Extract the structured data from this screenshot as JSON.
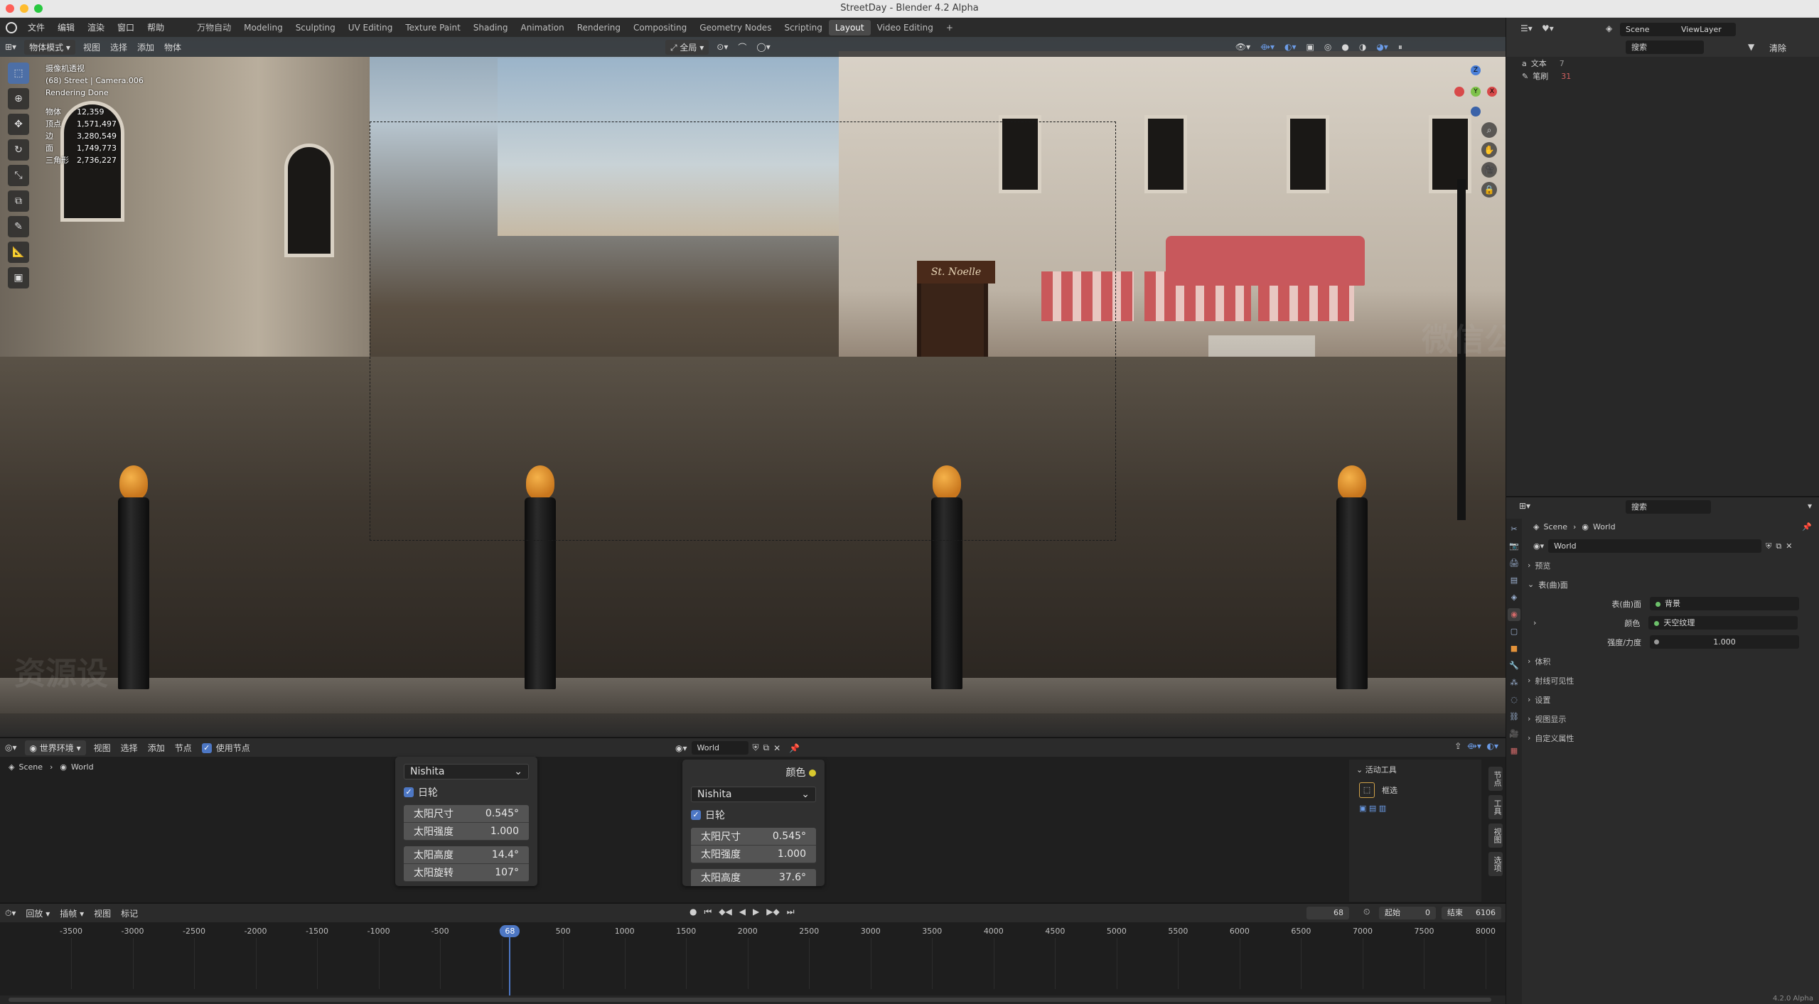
{
  "window": {
    "title": "StreetDay - Blender 4.2 Alpha",
    "traffic_lights": [
      "#fe5f57",
      "#febc2e",
      "#28c840"
    ]
  },
  "menu": [
    "文件",
    "编辑",
    "渲染",
    "窗口",
    "帮助"
  ],
  "workspaces": [
    "万物自动",
    "Modeling",
    "Sculpting",
    "UV Editing",
    "Texture Paint",
    "Shading",
    "Animation",
    "Rendering",
    "Compositing",
    "Geometry Nodes",
    "Scripting",
    "Layout",
    "Video Editing"
  ],
  "active_workspace": "Layout",
  "viewport": {
    "mode": "物体模式",
    "menus": [
      "视图",
      "选择",
      "添加",
      "物体"
    ],
    "transform_orientation": "全局",
    "overlay_title": "摄像机透视",
    "overlay_subtitle": "(68) Street | Camera.006",
    "render_status": "Rendering Done",
    "stats": [
      {
        "label": "物体",
        "value": "12,359"
      },
      {
        "label": "顶点",
        "value": "1,571,497"
      },
      {
        "label": "边",
        "value": "3,280,549"
      },
      {
        "label": "面",
        "value": "1,749,773"
      },
      {
        "label": "三角形",
        "value": "2,736,227"
      }
    ],
    "shop_sign": "St. Noelle",
    "watermark_left": "资源设",
    "watermark_right": "微信公"
  },
  "outliner": {
    "scene": "Scene",
    "view_layer": "ViewLayer",
    "search_placeholder": "搜索",
    "filter_label": "清除",
    "rows": [
      {
        "label": "文本",
        "count": "7"
      },
      {
        "label": "笔刷",
        "count": "31"
      }
    ]
  },
  "properties": {
    "search_placeholder": "搜索",
    "breadcrumb_scene": "Scene",
    "breadcrumb_world": "World",
    "world_name": "World",
    "sections": {
      "preview": "预览",
      "surface": "表(曲)面",
      "volume": "体积",
      "ray_visibility": "射线可见性",
      "settings": "设置",
      "viewport_display": "视图显示",
      "custom_props": "自定义属性"
    },
    "surface_label": "表(曲)面",
    "surface_value": "背景",
    "color_label": "颜色",
    "color_value": "天空纹理",
    "strength_label": "强度/力度",
    "strength_value": "1.000"
  },
  "node_editor": {
    "editor_type": "世界环境",
    "menus": [
      "视图",
      "选择",
      "添加",
      "节点"
    ],
    "use_nodes_label": "使用节点",
    "breadcrumb_scene": "Scene",
    "breadcrumb_world": "World",
    "world_name": "World",
    "node_left": {
      "sky_type": "Nishita",
      "sun_disc": "日轮",
      "fields": [
        {
          "label": "太阳尺寸",
          "value": "0.545°"
        },
        {
          "label": "太阳强度",
          "value": "1.000"
        },
        {
          "label": "太阳高度",
          "value": "14.4°"
        },
        {
          "label": "太阳旋转",
          "value": "107°"
        }
      ]
    },
    "node_right": {
      "output_label": "颜色",
      "sky_type": "Nishita",
      "sun_disc": "日轮",
      "fields": [
        {
          "label": "太阳尺寸",
          "value": "0.545°"
        },
        {
          "label": "太阳强度",
          "value": "1.000"
        },
        {
          "label": "太阳高度",
          "value": "37.6°"
        }
      ]
    },
    "tool_panel": {
      "header": "活动工具",
      "tool": "框选"
    },
    "sidebar_tabs": [
      "节点",
      "工具",
      "视图",
      "选项"
    ]
  },
  "timeline": {
    "menus": [
      "回放",
      "插帧",
      "视图",
      "标记"
    ],
    "current_frame": "68",
    "start_label": "起始",
    "start_value": "0",
    "end_label": "结束",
    "end_value": "6106",
    "ticks": [
      "-3500",
      "-3000",
      "-2500",
      "-2000",
      "-1500",
      "-1000",
      "-500",
      "0",
      "500",
      "1000",
      "1500",
      "2000",
      "2500",
      "3000",
      "3500",
      "4000",
      "4500",
      "5000",
      "5500",
      "6000",
      "6500",
      "7000",
      "7500",
      "8000"
    ],
    "playhead_fraction": 0.034
  },
  "status_bar": {
    "version": "4.2.0 Alpha"
  }
}
